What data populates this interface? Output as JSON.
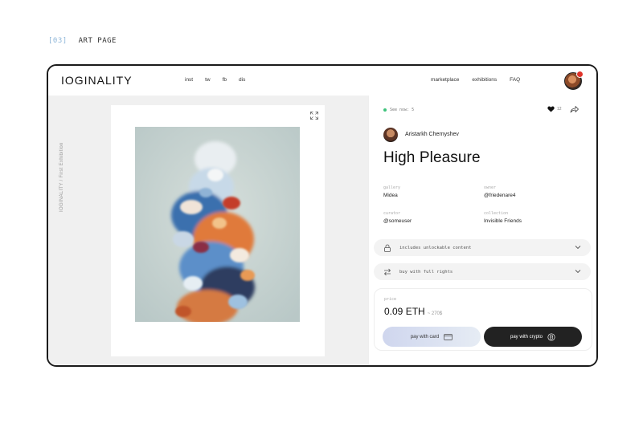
{
  "caption": {
    "number": "[03]",
    "label": "ART PAGE"
  },
  "header": {
    "logo": "IOGINALITY",
    "social": [
      "inst",
      "tw",
      "fb",
      "dis"
    ],
    "nav": [
      "marketplace",
      "exhibitions",
      "FAQ"
    ],
    "notification_color": "#e0342a"
  },
  "sidebar": {
    "vertical_label": "IOGINALITY / First Exhibition"
  },
  "artwork": {
    "expand_icon": "expand-icon"
  },
  "panel": {
    "status": "See now: 5",
    "likes": "12",
    "artist": "Aristarkh Chernyshev",
    "title": "High Pleasure",
    "meta": [
      {
        "key": "gallery",
        "value": "Midea"
      },
      {
        "key": "owner",
        "value": "@friedenare4"
      },
      {
        "key": "curator",
        "value": "@someuser"
      },
      {
        "key": "collection",
        "value": "Invisible Friends"
      }
    ],
    "unlockable": "includes unlockable content",
    "rights": "buy with full rights",
    "price_label": "price",
    "price": "0.09 ETH",
    "price_usd": "~ 270$",
    "pay_card": "pay with card",
    "pay_crypto": "pay with crypto",
    "accent_online": "#3fc37c"
  }
}
